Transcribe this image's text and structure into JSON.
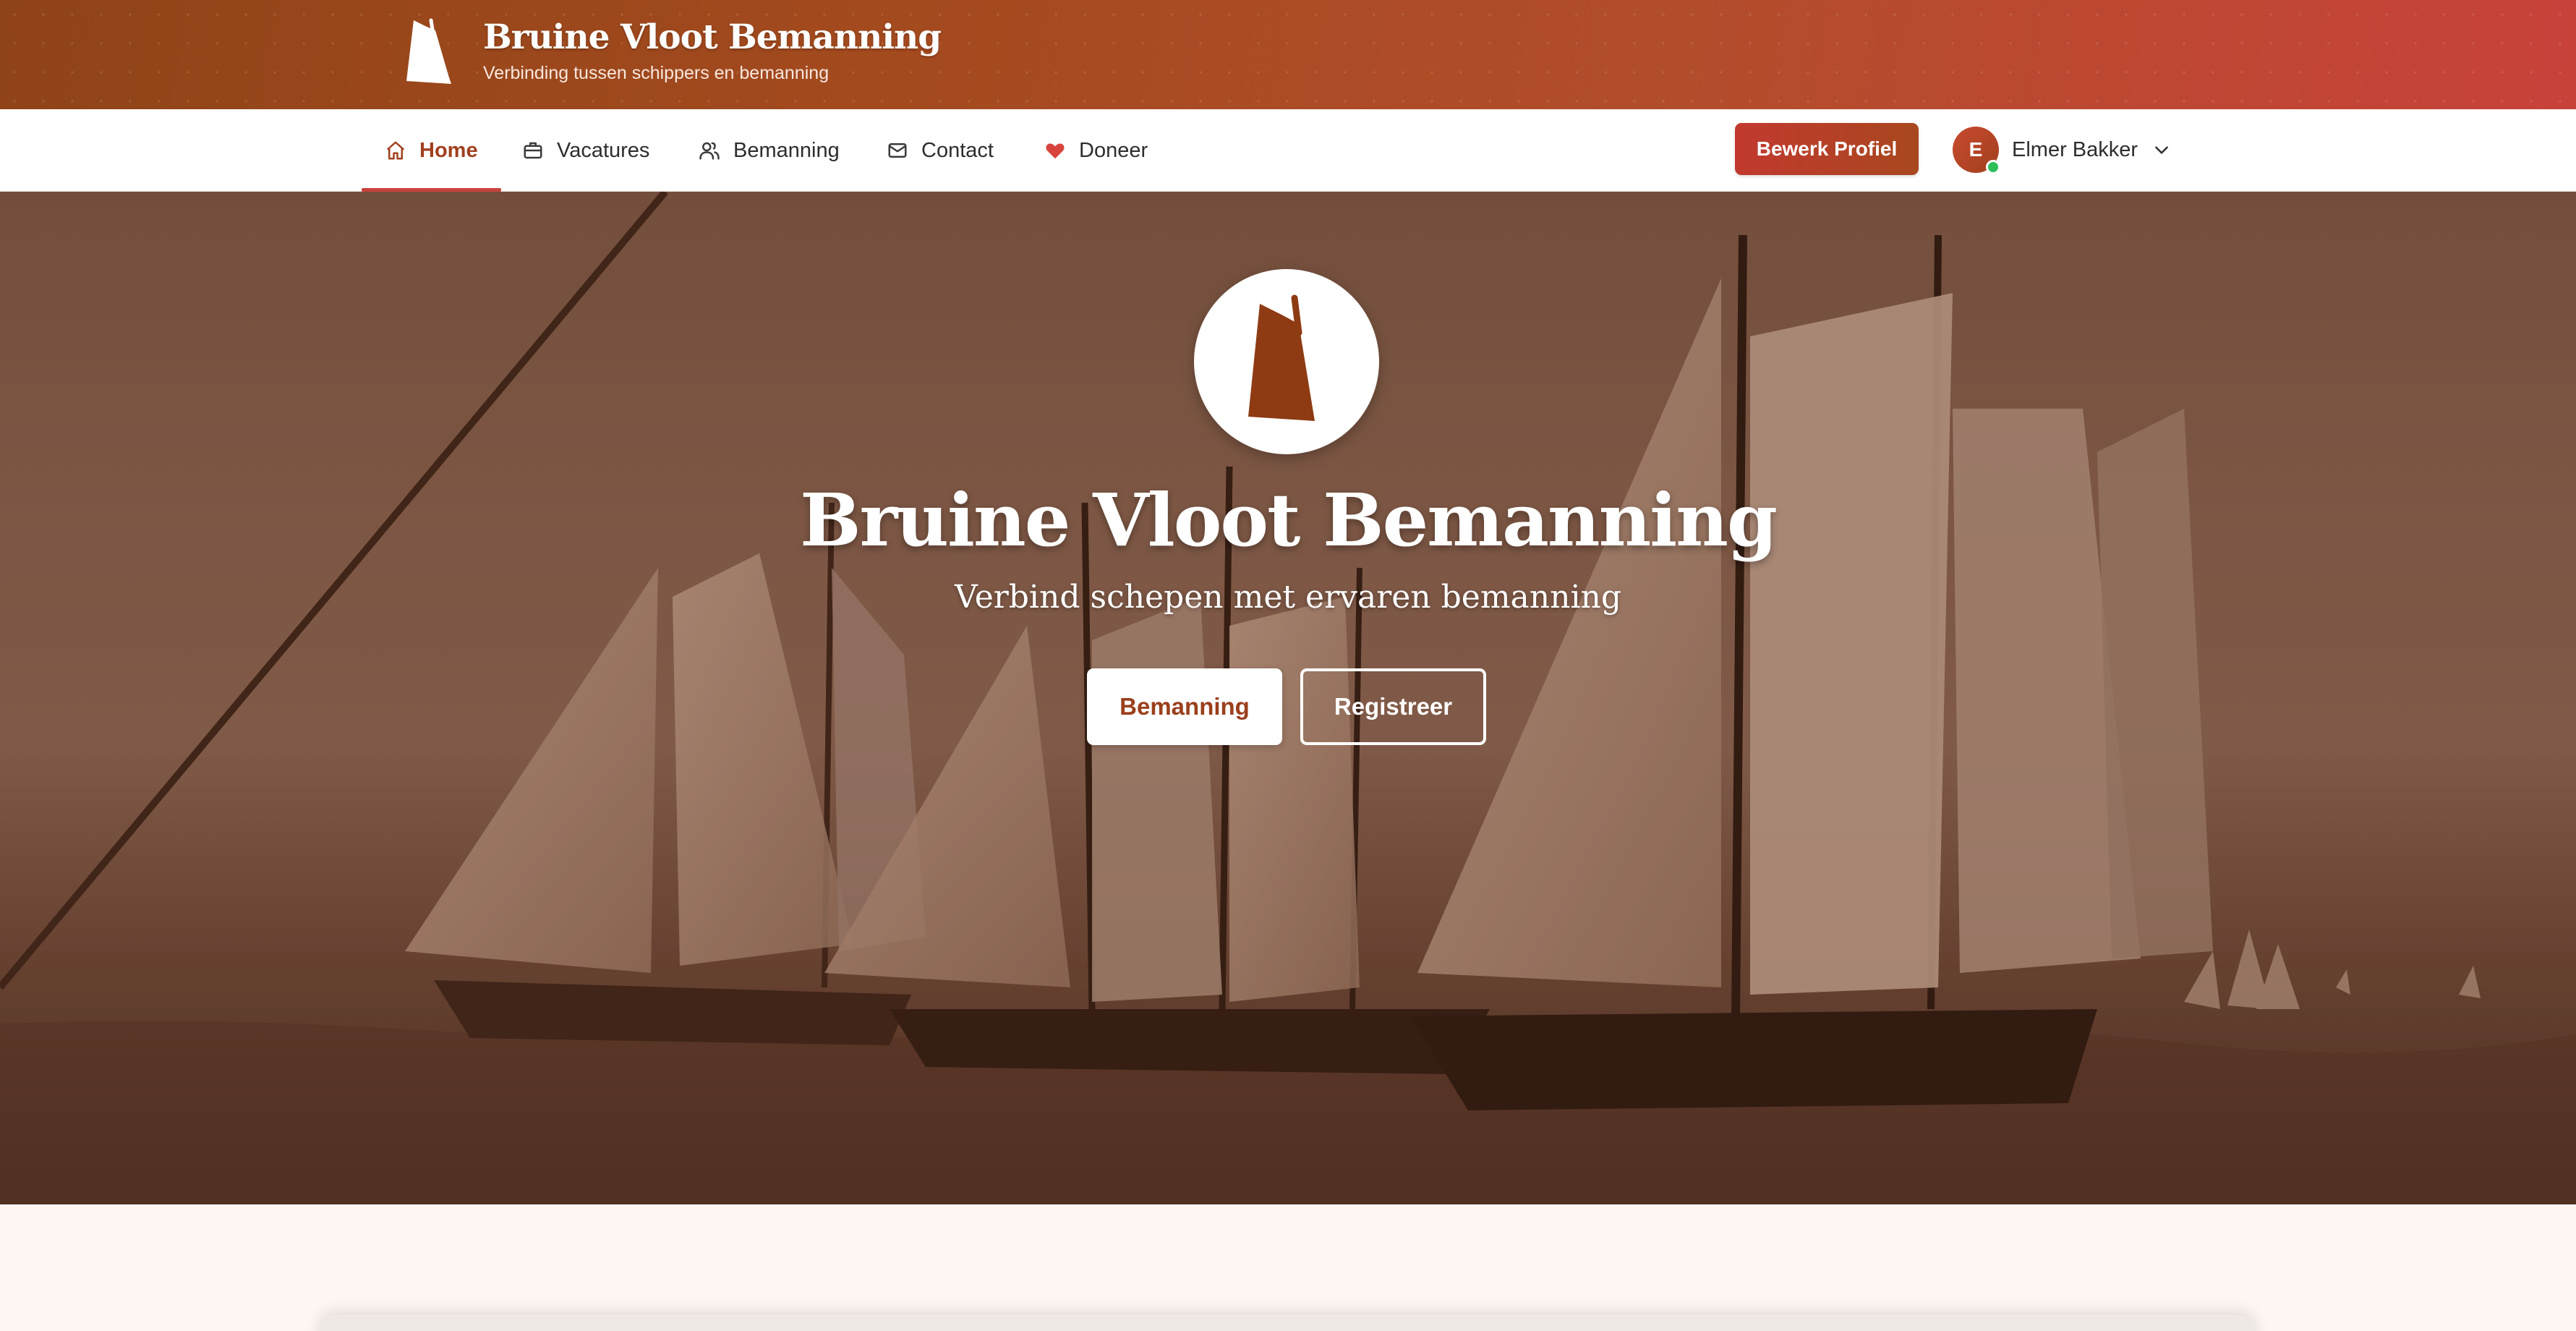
{
  "brand": {
    "title": "Bruine Vloot Bemanning",
    "subtitle": "Verbinding tussen schippers en bemanning",
    "logo_icon": "sail-icon"
  },
  "nav": {
    "items": [
      {
        "label": "Home",
        "icon": "home-icon",
        "active": true
      },
      {
        "label": "Vacatures",
        "icon": "briefcase-icon",
        "active": false
      },
      {
        "label": "Bemanning",
        "icon": "users-icon",
        "active": false
      },
      {
        "label": "Contact",
        "icon": "envelope-icon",
        "active": false
      },
      {
        "label": "Doneer",
        "icon": "heart-icon",
        "active": false
      }
    ],
    "edit_profile_label": "Bewerk Profiel",
    "user": {
      "initial": "E",
      "name": "Elmer Bakker",
      "status": "online"
    }
  },
  "hero": {
    "title": "Bruine Vloot Bemanning",
    "subtitle": "Verbind schepen met ervaren bemanning",
    "primary_button": "Bemanning",
    "secondary_button": "Registreer",
    "logo_icon": "sail-icon"
  },
  "colors": {
    "accent": "#a1401f",
    "brand_gradient_start": "#8f4417",
    "brand_gradient_end": "#c8423a",
    "online": "#2fbf5a"
  }
}
